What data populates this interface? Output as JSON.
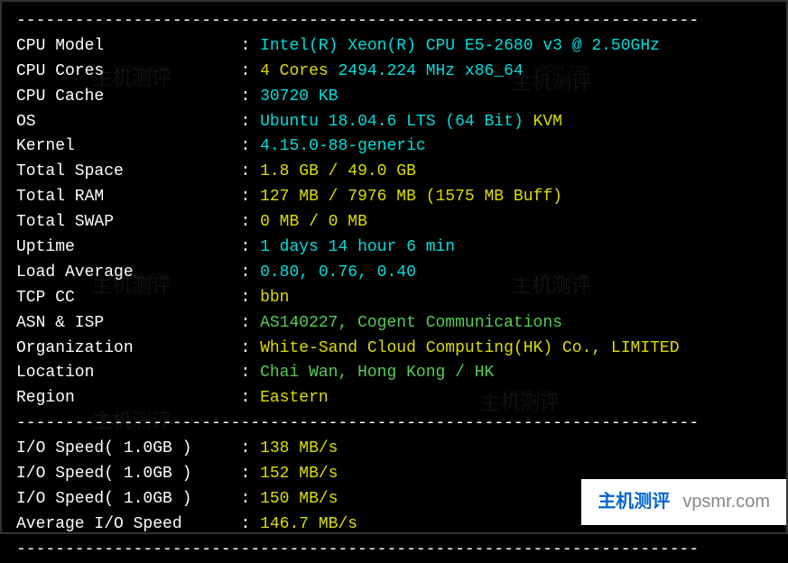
{
  "divider": "----------------------------------------------------------------------",
  "rows": [
    {
      "label": "CPU Model",
      "value": "Intel(R) Xeon(R) CPU E5-2680 v3 @ 2.50GHz",
      "color": "cyan"
    },
    {
      "label": "CPU Cores",
      "prefix": "4 Cores",
      "prefixColor": "yellow",
      "value": " 2494.224 MHz x86_64",
      "color": "cyan"
    },
    {
      "label": "CPU Cache",
      "value": "30720 KB",
      "color": "cyan"
    },
    {
      "label": "OS",
      "value": "Ubuntu 18.04.6 LTS (64 Bit)",
      "color": "cyan",
      "suffix": " KVM",
      "suffixColor": "yellow"
    },
    {
      "label": "Kernel",
      "value": "4.15.0-88-generic",
      "color": "cyan"
    },
    {
      "label": "Total Space",
      "value": "1.8 GB / 49.0 GB",
      "color": "yellow"
    },
    {
      "label": "Total RAM",
      "value": "127 MB / 7976 MB (1575 MB Buff)",
      "color": "yellow"
    },
    {
      "label": "Total SWAP",
      "value": "0 MB / 0 MB",
      "color": "yellow"
    },
    {
      "label": "Uptime",
      "value": "1 days 14 hour 6 min",
      "color": "cyan"
    },
    {
      "label": "Load Average",
      "value": "0.80, 0.76, 0.40",
      "color": "cyan"
    },
    {
      "label": "TCP CC",
      "value": "bbn",
      "color": "yellow"
    },
    {
      "label": "ASN & ISP",
      "value": "AS140227, Cogent Communications",
      "color": "green"
    },
    {
      "label": "Organization",
      "value": "White-Sand Cloud Computing(HK) Co., LIMITED",
      "color": "yellow"
    },
    {
      "label": "Location",
      "value": "Chai Wan, Hong Kong / HK",
      "color": "green"
    },
    {
      "label": "Region",
      "value": "Eastern",
      "color": "yellow"
    }
  ],
  "io_rows": [
    {
      "label": "I/O Speed( 1.0GB )",
      "value": "138 MB/s"
    },
    {
      "label": "I/O Speed( 1.0GB )",
      "value": "152 MB/s"
    },
    {
      "label": "I/O Speed( 1.0GB )",
      "value": "150 MB/s"
    },
    {
      "label": "Average I/O Speed",
      "value": "146.7 MB/s"
    }
  ],
  "watermark": {
    "cn": "主机测评",
    "url": "VPSMR.COM"
  },
  "banner": {
    "cn": "主机测评",
    "url": "vpsmr.com"
  }
}
